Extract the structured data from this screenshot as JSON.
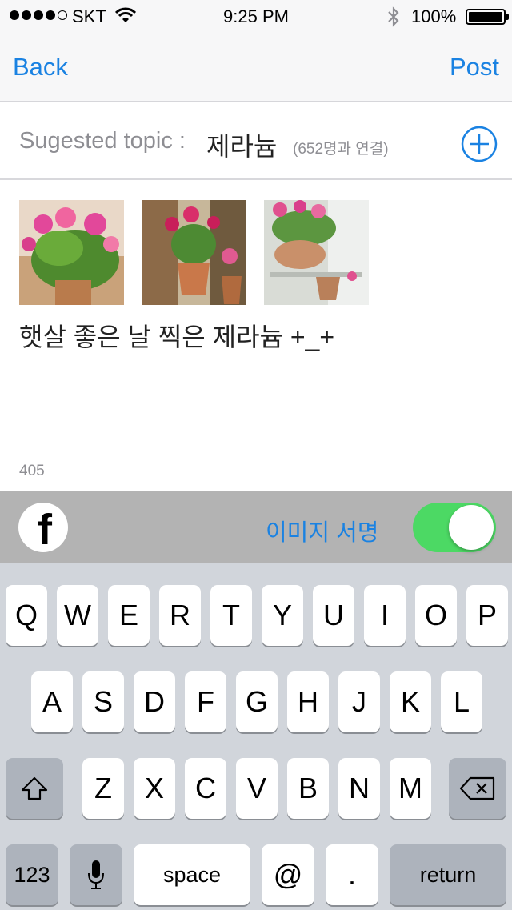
{
  "status_bar": {
    "carrier": "SKT",
    "time": "9:25 PM",
    "battery": "100%",
    "icons": [
      "signal-dots",
      "wifi-icon",
      "bluetooth-icon",
      "battery-icon"
    ]
  },
  "nav": {
    "back_label": "Back",
    "post_label": "Post"
  },
  "topic": {
    "label": "Sugested topic :",
    "name": "제라늄",
    "meta": "(652명과 연결)",
    "add_icon": "plus-circle-icon"
  },
  "compose": {
    "photos": [
      "geranium photo 1",
      "geranium photo 2",
      "geranium photo 3"
    ],
    "text": "햇살 좋은 날 찍은 제라늄 +_+",
    "char_count": "405"
  },
  "share": {
    "facebook_icon": "facebook-icon",
    "signature_label": "이미지 서명",
    "signature_enabled": true
  },
  "keyboard": {
    "row1": [
      "Q",
      "W",
      "E",
      "R",
      "T",
      "Y",
      "U",
      "I",
      "O",
      "P"
    ],
    "row2": [
      "A",
      "S",
      "D",
      "F",
      "G",
      "H",
      "J",
      "K",
      "L"
    ],
    "row3": [
      "Z",
      "X",
      "C",
      "V",
      "B",
      "N",
      "M"
    ],
    "numbers_label": "123",
    "space_label": "space",
    "at_label": "@",
    "period_label": ".",
    "return_label": "return",
    "icons": [
      "shift-icon",
      "backspace-icon",
      "microphone-icon"
    ]
  },
  "colors": {
    "accent": "#1a82e2",
    "toggle_on": "#4cd964",
    "share_bar": "#b3b3b3",
    "keyboard_bg": "#d1d5db"
  }
}
